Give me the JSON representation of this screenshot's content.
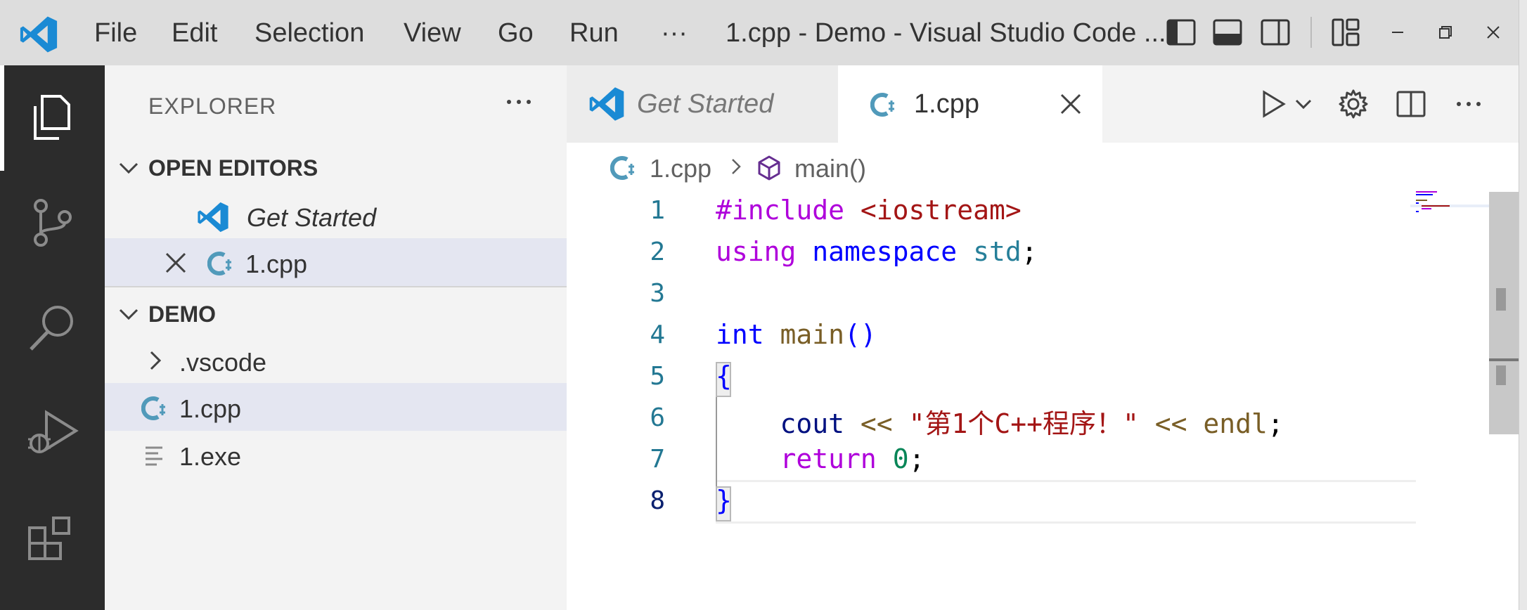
{
  "titlebar": {
    "menu": [
      "File",
      "Edit",
      "Selection",
      "View",
      "Go",
      "Run",
      "···"
    ],
    "title": "1.cpp - Demo - Visual Studio Code ..."
  },
  "activitybar": {
    "items": [
      "explorer-icon",
      "source-control-icon",
      "search-icon",
      "run-debug-icon",
      "extensions-icon"
    ]
  },
  "sidebar": {
    "header": "EXPLORER",
    "open_editors": {
      "label": "OPEN EDITORS",
      "items": [
        "Get Started",
        "1.cpp"
      ]
    },
    "workspace": {
      "label": "DEMO",
      "items": [
        ".vscode",
        "1.cpp",
        "1.exe"
      ]
    }
  },
  "tabs": [
    {
      "label": "Get Started"
    },
    {
      "label": "1.cpp"
    }
  ],
  "breadcrumb": {
    "file": "1.cpp",
    "symbol": "main()"
  },
  "editor": {
    "line_numbers": [
      "1",
      "2",
      "3",
      "4",
      "5",
      "6",
      "7",
      "8"
    ],
    "tokens": {
      "l1_pre": "#include",
      "l1_hdr": "<iostream>",
      "l2_using": "using",
      "l2_ns_kw": "namespace",
      "l2_std": "std",
      "l2_semi": ";",
      "l4_int": "int",
      "l4_main": "main",
      "l4_parens": "()",
      "l5_brace": "{",
      "l6_cout": "cout",
      "l6_op1": "<<",
      "l6_str": "\"第1个C++程序！\"",
      "l6_op2": "<<",
      "l6_endl": "endl",
      "l6_semi": ";",
      "l7_return": "return",
      "l7_zero": "0",
      "l7_semi": ";",
      "l8_brace": "}"
    }
  },
  "colors": {
    "accent": "#007acc",
    "cpp_icon": "#519aba",
    "activity_bg": "#2c2c2c",
    "sidebar_bg": "#f3f3f3"
  }
}
